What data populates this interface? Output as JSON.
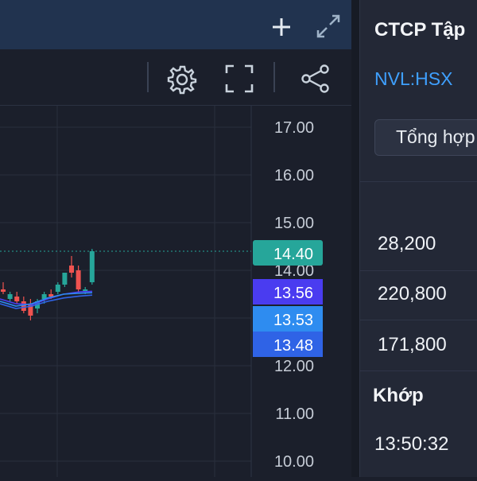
{
  "toolbar": {
    "add_icon": "plus-icon",
    "expand_icon": "expand-arrows-icon",
    "settings_icon": "gear-icon",
    "fullscreen_icon": "fullscreen-icon",
    "share_icon": "share-icon"
  },
  "chart": {
    "price_labels": [
      "17.00",
      "16.00",
      "15.00",
      "14.00",
      "12.00",
      "11.00",
      "10.00"
    ],
    "current_price": "14.40",
    "ma_labels": [
      "13.56",
      "13.53",
      "13.48"
    ],
    "colors": {
      "up": "#26a69a",
      "down": "#ef5350",
      "current_tag": "#26a69a",
      "ma1": "#4a3cf0",
      "ma2": "#2e8cf0",
      "ma3": "#2f63e6"
    }
  },
  "chart_data": {
    "type": "line",
    "title": "",
    "xlabel": "",
    "ylabel": "",
    "ylim": [
      10.0,
      17.0
    ],
    "y_ticks": [
      17.0,
      16.0,
      15.0,
      14.0,
      12.0,
      11.0,
      10.0
    ],
    "last_price": 14.4,
    "series": [
      {
        "values": [
          13.56
        ]
      },
      {
        "values": [
          13.53
        ]
      },
      {
        "values": [
          13.48
        ]
      }
    ],
    "candles": [
      {
        "o": 13.6,
        "h": 13.75,
        "l": 13.5,
        "c": 13.55
      },
      {
        "o": 13.4,
        "h": 13.55,
        "l": 13.35,
        "c": 13.5
      },
      {
        "o": 13.45,
        "h": 13.55,
        "l": 13.3,
        "c": 13.35
      },
      {
        "o": 13.35,
        "h": 13.45,
        "l": 13.1,
        "c": 13.15
      },
      {
        "o": 13.3,
        "h": 13.4,
        "l": 12.95,
        "c": 13.05
      },
      {
        "o": 13.2,
        "h": 13.4,
        "l": 13.1,
        "c": 13.35
      },
      {
        "o": 13.4,
        "h": 13.55,
        "l": 13.3,
        "c": 13.5
      },
      {
        "o": 13.5,
        "h": 13.6,
        "l": 13.4,
        "c": 13.45
      },
      {
        "o": 13.55,
        "h": 13.75,
        "l": 13.5,
        "c": 13.7
      },
      {
        "o": 13.7,
        "h": 13.95,
        "l": 13.65,
        "c": 13.95
      },
      {
        "o": 14.1,
        "h": 14.3,
        "l": 13.85,
        "c": 13.95
      },
      {
        "o": 14.0,
        "h": 14.1,
        "l": 13.55,
        "c": 13.6
      },
      {
        "o": 13.55,
        "h": 13.65,
        "l": 13.5,
        "c": 13.6
      },
      {
        "o": 13.75,
        "h": 14.45,
        "l": 13.7,
        "c": 14.4
      }
    ]
  },
  "panel": {
    "company": "CTCP Tập",
    "ticker": "NVL:HSX",
    "tab_label": "Tổng hợp",
    "values": [
      "28,200",
      "220,800",
      "171,800"
    ],
    "match_label": "Khớp",
    "time": "13:50:32"
  }
}
